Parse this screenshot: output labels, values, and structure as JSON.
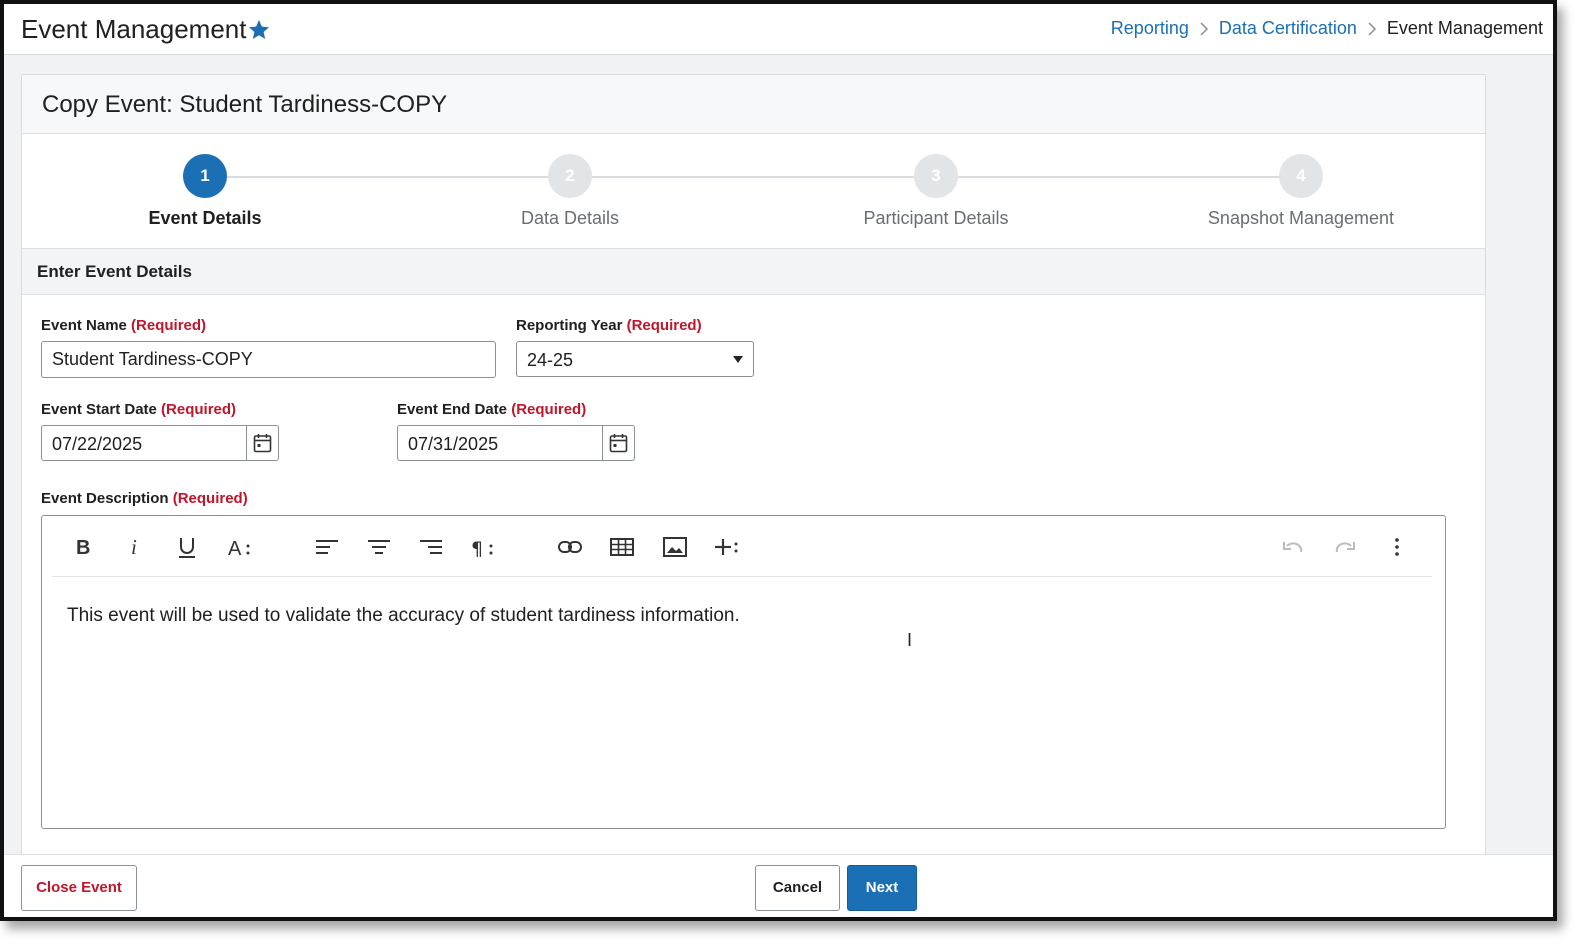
{
  "header": {
    "title": "Event Management",
    "breadcrumb": [
      "Reporting",
      "Data Certification",
      "Event Management"
    ]
  },
  "card": {
    "title": "Copy Event: Student Tardiness-COPY"
  },
  "stepper": {
    "steps": [
      {
        "number": "1",
        "label": "Event Details",
        "active": true
      },
      {
        "number": "2",
        "label": "Data Details",
        "active": false
      },
      {
        "number": "3",
        "label": "Participant Details",
        "active": false
      },
      {
        "number": "4",
        "label": "Snapshot Management",
        "active": false
      }
    ]
  },
  "section": {
    "title": "Enter Event Details"
  },
  "form": {
    "required_text": "(Required)",
    "event_name": {
      "label": "Event Name",
      "value": "Student Tardiness-COPY"
    },
    "reporting_year": {
      "label": "Reporting Year",
      "value": "24-25"
    },
    "start_date": {
      "label": "Event Start Date",
      "value": "07/22/2025"
    },
    "end_date": {
      "label": "Event End Date",
      "value": "07/31/2025"
    },
    "description": {
      "label": "Event Description",
      "value": "This event will be used to validate the accuracy of student tardiness information."
    }
  },
  "toolbar": {
    "icons": [
      "bold-icon",
      "italic-icon",
      "underline-icon",
      "font-size-icon",
      "align-left-icon",
      "align-center-icon",
      "align-right-icon",
      "paragraph-format-icon",
      "link-icon",
      "table-icon",
      "image-icon",
      "insert-more-icon",
      "undo-icon",
      "redo-icon",
      "more-options-icon"
    ]
  },
  "footer": {
    "close_label": "Close Event",
    "cancel_label": "Cancel",
    "next_label": "Next"
  },
  "colors": {
    "accent": "#1a6fb5",
    "required": "#c0162b"
  }
}
